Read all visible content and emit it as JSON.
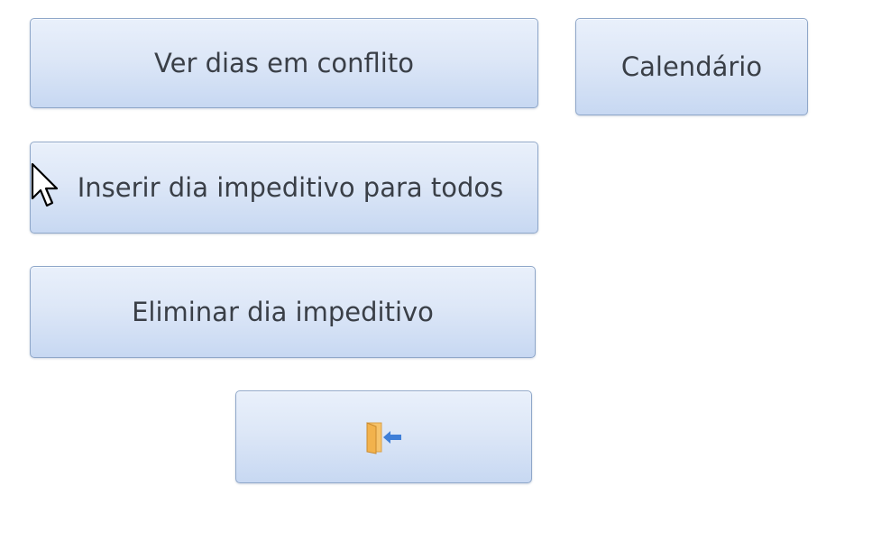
{
  "buttons": {
    "conflict_days": "Ver dias em conflito",
    "calendar": "Calendário",
    "insert_blocking_day_all": "Inserir dia impeditivo para todos",
    "delete_blocking_day": "Eliminar dia impeditivo",
    "exit_icon": "exit-door-icon"
  },
  "colors": {
    "button_top": "#e9f0fb",
    "button_bottom": "#c7d8f2",
    "button_border": "#8fa7c9",
    "text": "#3a3f47"
  }
}
